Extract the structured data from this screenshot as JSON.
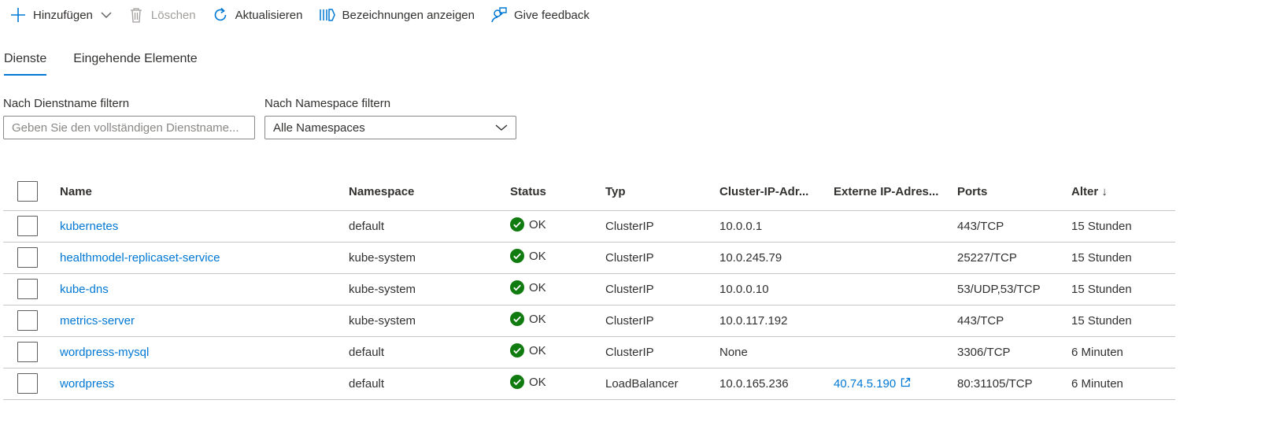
{
  "toolbar": {
    "add_label": "Hinzufügen",
    "delete_label": "Löschen",
    "refresh_label": "Aktualisieren",
    "labels_label": "Bezeichnungen anzeigen",
    "feedback_label": "Give feedback"
  },
  "tabs": [
    {
      "label": "Dienste",
      "active": true
    },
    {
      "label": "Eingehende Elemente",
      "active": false
    }
  ],
  "filters": {
    "name_label": "Nach Dienstname filtern",
    "name_placeholder": "Geben Sie den vollständigen Dienstname...",
    "namespace_label": "Nach Namespace filtern",
    "namespace_value": "Alle Namespaces"
  },
  "table": {
    "columns": [
      "Name",
      "Namespace",
      "Status",
      "Typ",
      "Cluster-IP-Adr...",
      "Externe IP-Adres...",
      "Ports",
      "Alter ↓"
    ],
    "rows": [
      {
        "name": "kubernetes",
        "namespace": "default",
        "status": "OK",
        "type": "ClusterIP",
        "cluster_ip": "10.0.0.1",
        "external_ip": "",
        "ports": "443/TCP",
        "age": "15 Stunden"
      },
      {
        "name": "healthmodel-replicaset-service",
        "namespace": "kube-system",
        "status": "OK",
        "type": "ClusterIP",
        "cluster_ip": "10.0.245.79",
        "external_ip": "",
        "ports": "25227/TCP",
        "age": "15 Stunden"
      },
      {
        "name": "kube-dns",
        "namespace": "kube-system",
        "status": "OK",
        "type": "ClusterIP",
        "cluster_ip": "10.0.0.10",
        "external_ip": "",
        "ports": "53/UDP,53/TCP",
        "age": "15 Stunden"
      },
      {
        "name": "metrics-server",
        "namespace": "kube-system",
        "status": "OK",
        "type": "ClusterIP",
        "cluster_ip": "10.0.117.192",
        "external_ip": "",
        "ports": "443/TCP",
        "age": "15 Stunden"
      },
      {
        "name": "wordpress-mysql",
        "namespace": "default",
        "status": "OK",
        "type": "ClusterIP",
        "cluster_ip": "None",
        "external_ip": "",
        "ports": "3306/TCP",
        "age": "6 Minuten"
      },
      {
        "name": "wordpress",
        "namespace": "default",
        "status": "OK",
        "type": "LoadBalancer",
        "cluster_ip": "10.0.165.236",
        "external_ip": "40.74.5.190",
        "ports": "80:31105/TCP",
        "age": "6 Minuten"
      }
    ]
  },
  "colors": {
    "accent": "#0078d4",
    "ok_green": "#107c10",
    "disabled": "#a19f9d"
  }
}
